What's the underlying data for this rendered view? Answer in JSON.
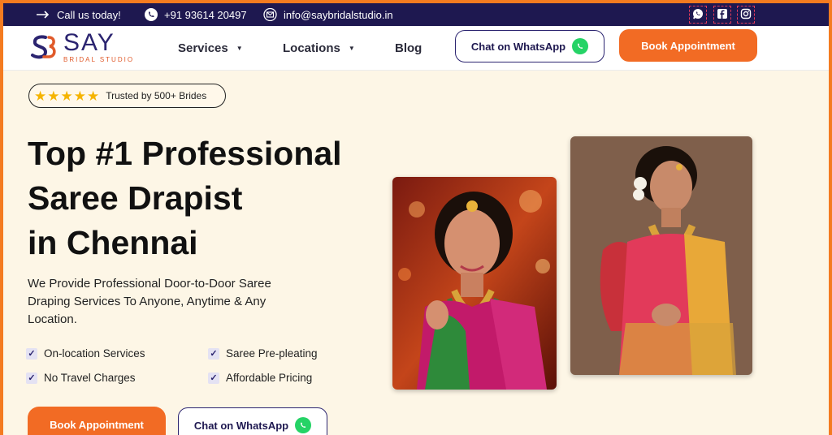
{
  "topbar": {
    "call_label": "Call us today!",
    "phone": "+91 93614 20497",
    "email": "info@saybridalstudio.in"
  },
  "brand": {
    "name": "SAY",
    "subtitle": "BRIDAL STUDIO"
  },
  "nav": {
    "items": [
      {
        "label": "Services",
        "dropdown": true
      },
      {
        "label": "Locations",
        "dropdown": true
      },
      {
        "label": "Blog",
        "dropdown": false
      }
    ],
    "whatsapp_label": "Chat on WhatsApp",
    "book_label": "Book Appointment"
  },
  "hero": {
    "trust_badge": "Trusted by 500+ Brides",
    "rating_stars": 5,
    "headline": [
      "Top #1 Professional",
      "Saree Drapist",
      "in Chennai"
    ],
    "description": "We Provide Professional Door-to-Door Saree Draping Services To Anyone, Anytime & Any Location.",
    "features": [
      "On-location Services",
      "Saree Pre-pleating",
      "No Travel Charges",
      "Affordable Pricing"
    ],
    "book_label": "Book Appointment",
    "whatsapp_label": "Chat on WhatsApp"
  },
  "colors": {
    "navy": "#1e1850",
    "orange": "#f26b24",
    "cream": "#fdf6e6",
    "whatsapp": "#25d366"
  },
  "icons": {
    "topbar": [
      "arrow-right-icon",
      "phone-icon",
      "mail-icon"
    ],
    "social": [
      "whatsapp-icon",
      "facebook-icon",
      "instagram-icon"
    ]
  }
}
